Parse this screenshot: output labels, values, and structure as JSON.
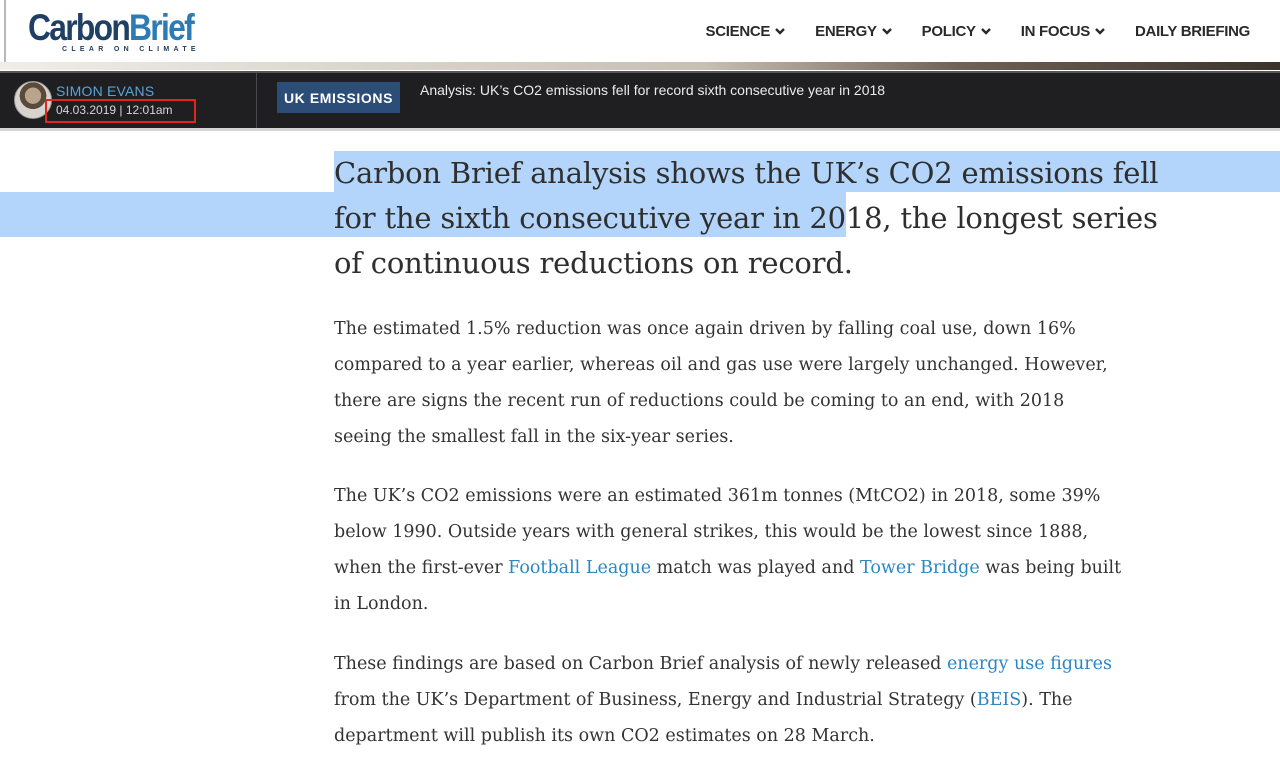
{
  "header": {
    "logo": {
      "part1": "Carbon",
      "part2": "Brief",
      "tagline": "CLEAR ON CLIMATE"
    },
    "nav": [
      {
        "label": "SCIENCE",
        "dropdown": true
      },
      {
        "label": "ENERGY",
        "dropdown": true
      },
      {
        "label": "POLICY",
        "dropdown": true
      },
      {
        "label": "IN FOCUS",
        "dropdown": true
      },
      {
        "label": "DAILY BRIEFING",
        "dropdown": false
      }
    ]
  },
  "article_bar": {
    "author": "SIMON EVANS",
    "date": "04.03.2019 | 12:01am",
    "category": "UK EMISSIONS",
    "headline": "Analysis: UK’s CO2 emissions fell for record sixth consecutive year in 2018"
  },
  "article": {
    "lead_lines": [
      "Carbon Brief analysis shows the UK’s CO2 emissions fell",
      {
        "before": "for the sixth consecutive year in 2018,",
        "after": " the longest series"
      },
      "of continuous reductions on record."
    ],
    "p1": [
      "The estimated 1.5% reduction was once again driven by falling coal use, down 16%",
      "compared to a year earlier, whereas oil and gas use were largely unchanged. However,",
      "there are signs the recent run of reductions could be coming to an end, with 2018",
      "seeing the smallest fall in the six-year series."
    ],
    "p2": {
      "line1": "The UK’s CO2 emissions were an estimated 361m tonnes (MtCO2) in 2018, some 39%",
      "line2": "below 1990. Outside years with general strikes, this would be the lowest since 1888,",
      "line3_pre": "when the first-ever ",
      "link1": "Football League",
      "line3_mid": " match was played and ",
      "link2": "Tower Bridge",
      "line3_post": " was being built",
      "line4": "in London."
    },
    "p3": {
      "line1_pre": "These findings are based on Carbon Brief analysis of newly released ",
      "link1": "energy use figures",
      "line2_pre": "from the UK’s Department of Business, Energy and Industrial Strategy (",
      "link2": "BEIS",
      "line2_post": "). The",
      "line3": "department will publish its own CO2 estimates on 28 March."
    }
  },
  "colors": {
    "link": "#2e86c1",
    "selection": "#b4d5fb",
    "category_bg": "#2c4d78",
    "author": "#5aa3d8",
    "highlight_box": "#e0251b"
  }
}
